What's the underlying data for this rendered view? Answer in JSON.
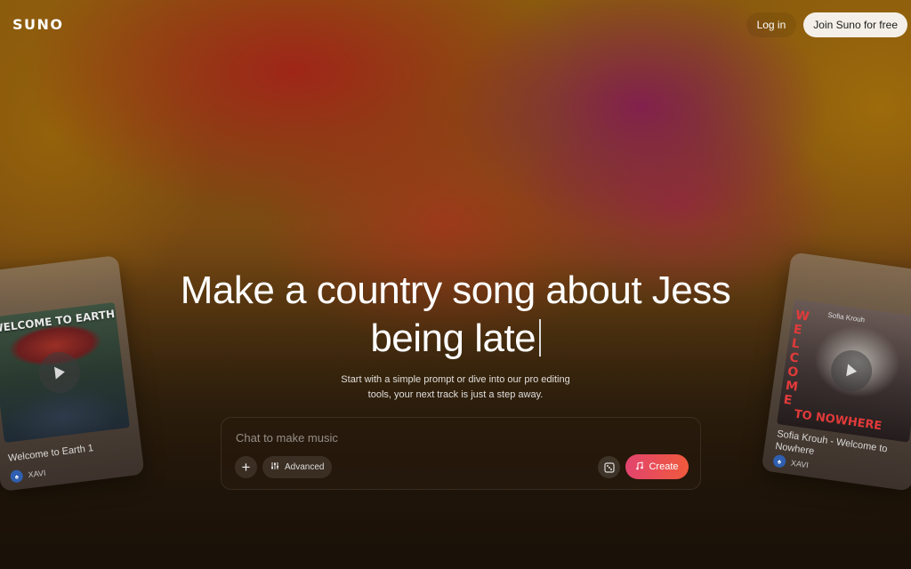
{
  "header": {
    "logo": "SUNO",
    "login_label": "Log in",
    "join_label": "Join Suno for free"
  },
  "hero": {
    "title_line1": "Make a country song about Jess",
    "title_line2": "being late",
    "subtitle_line1": "Start with a simple prompt or dive into our pro editing",
    "subtitle_line2": "tools, your next track is just a step away."
  },
  "prompt": {
    "placeholder": "Chat to make music",
    "plus_label": "+",
    "advanced_label": "Advanced",
    "create_label": "Create"
  },
  "cards": {
    "left": {
      "art_text": "WELCOME TO EARTH",
      "title": "Welcome to Earth 1",
      "artist": "XAVI"
    },
    "right": {
      "art_side_text": "WELCOME",
      "art_bottom_text": "TO NOWHERE",
      "art_small_text": "Sofia Krouh",
      "title": "Sofia Krouh - Welcome to Nowhere",
      "artist": "XAVI"
    }
  },
  "colors": {
    "create_gradient_start": "#e2446e",
    "create_gradient_end": "#ef5a3c",
    "join_button_bg": "#f4efe8"
  }
}
